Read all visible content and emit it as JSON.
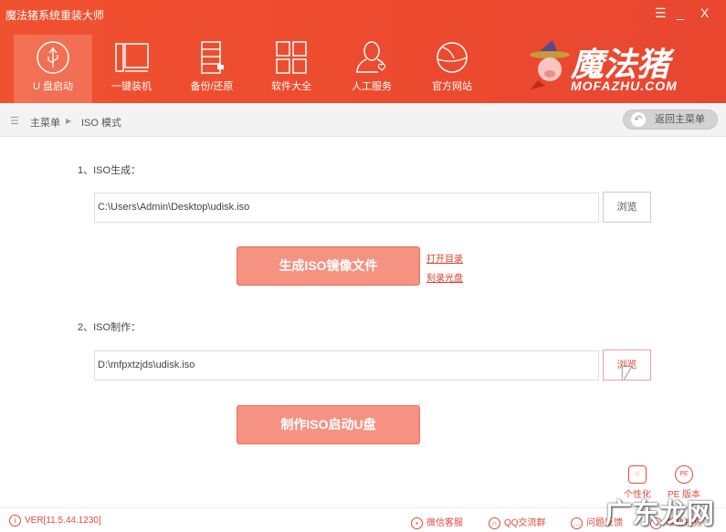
{
  "window": {
    "title": "魔法猪系统重装大师",
    "controls": [
      "menu-icon",
      "minimize-icon",
      "close-icon"
    ],
    "menu_glyph": "☰",
    "min_glyph": "_",
    "close_glyph": "X"
  },
  "nav": [
    {
      "label": "U 盘启动",
      "icon": "usb-icon",
      "active": true
    },
    {
      "label": "一键装机",
      "icon": "computer-icon"
    },
    {
      "label": "备份/还原",
      "icon": "backup-icon"
    },
    {
      "label": "软件大全",
      "icon": "grid-icon"
    },
    {
      "label": "人工服务",
      "icon": "person-icon"
    },
    {
      "label": "官方网站",
      "icon": "globe-icon"
    }
  ],
  "logo": {
    "text": "魔法猪",
    "url_text": "MOFAZHU.COM"
  },
  "breadcrumb": {
    "home": "主菜单",
    "current": "ISO 模式",
    "back": "返回主菜单"
  },
  "section1": {
    "label": "1、ISO生成：",
    "path": "C:\\Users\\Admin\\Desktop\\udisk.iso",
    "browse": "浏览",
    "button": "生成ISO镜像文件",
    "link_open": "打开目录",
    "link_burn": "刻录光盘"
  },
  "section2": {
    "label": "2、ISO制作：",
    "path": "D:\\mfpxtzjds\\udisk.iso",
    "browse": "浏览",
    "button": "制作ISO启动U盘"
  },
  "tools": {
    "personalize": "个性化",
    "pe": "PE 版本",
    "pe_icon_text": "PE"
  },
  "footer": {
    "version": "VER[11.5.44.1230]",
    "wechat": "微信客服",
    "qq": "QQ交流群",
    "feedback": "问题反馈",
    "help": "帮助视频"
  },
  "watermark": "广东龙网",
  "colors": {
    "brand": "#ec4a2f",
    "button": "#f59282",
    "link": "#d9402e"
  }
}
